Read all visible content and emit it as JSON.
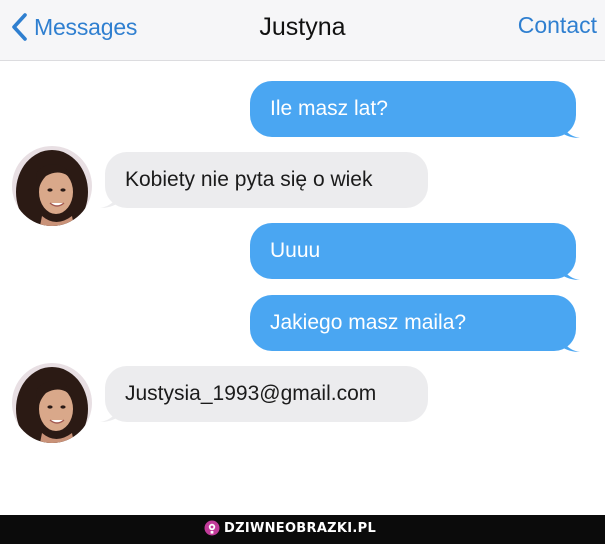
{
  "header": {
    "back_label": "Messages",
    "title": "Justyna",
    "contact_label": "Contact"
  },
  "messages": [
    {
      "direction": "outgoing",
      "text": "Ile masz lat?"
    },
    {
      "direction": "incoming",
      "text": "Kobiety nie pyta się o wiek"
    },
    {
      "direction": "outgoing",
      "text": "Uuuu"
    },
    {
      "direction": "outgoing",
      "text": "Jakiego masz maila?"
    },
    {
      "direction": "incoming",
      "text": "Justysia_1993@gmail.com"
    }
  ],
  "footer": {
    "watermark": "DZIWNEOBRAZKI.PL"
  },
  "colors": {
    "ios_blue": "#2f7fd0",
    "outgoing_bubble": "#4aa6f2",
    "incoming_bubble": "#ececee",
    "footer_bg": "#0b0b0b"
  },
  "icons": {
    "back": "chevron-left-icon",
    "watermark_logo": "dziwneobrazki-logo-icon"
  }
}
